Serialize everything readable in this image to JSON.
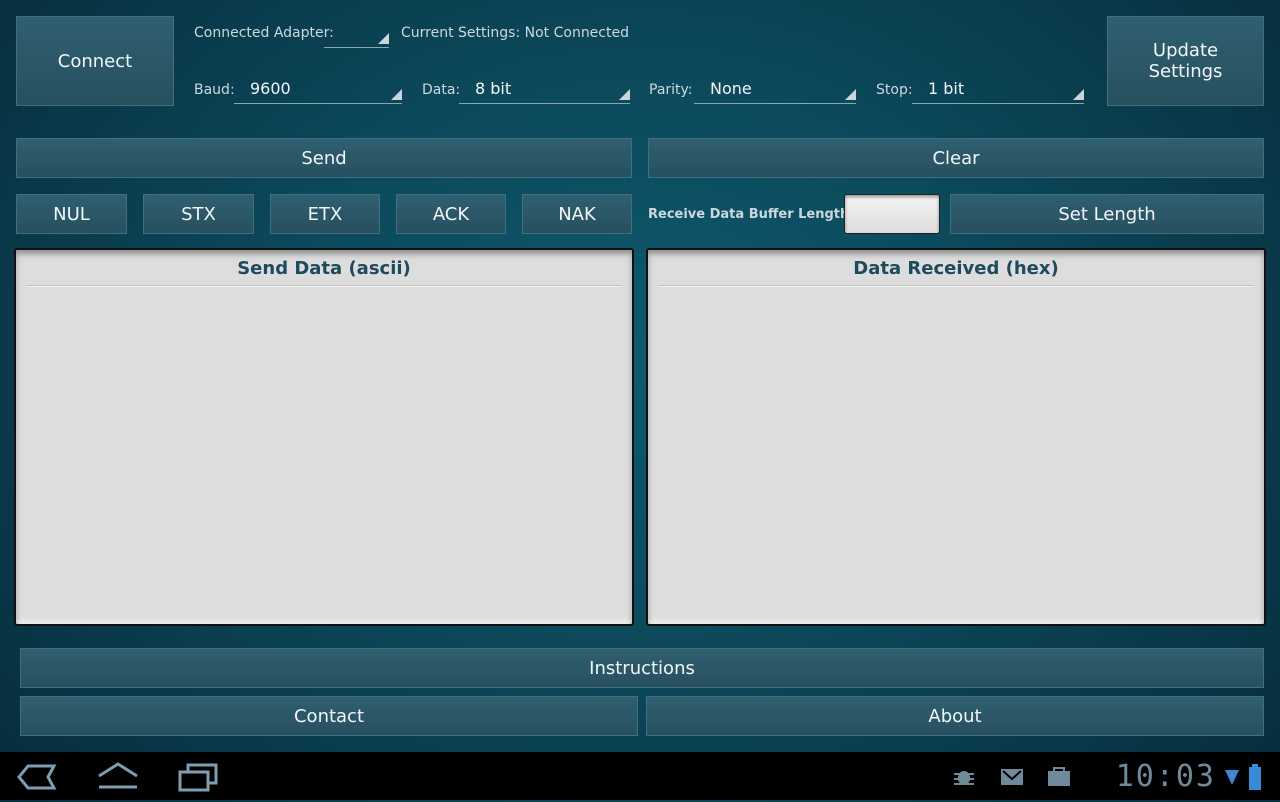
{
  "top": {
    "connect_label": "Connect",
    "update_label_line1": "Update",
    "update_label_line2": "Settings",
    "connected_adapter_label": "Connected Adapter:",
    "connected_adapter_value": "",
    "current_settings": "Current Settings: Not Connected",
    "baud_label": "Baud:",
    "baud_value": "9600",
    "data_label": "Data:",
    "data_value": "8 bit",
    "parity_label": "Parity:",
    "parity_value": "None",
    "stop_label": "Stop:",
    "stop_value": "1 bit"
  },
  "actions": {
    "send_label": "Send",
    "clear_label": "Clear",
    "control_chars": [
      "NUL",
      "STX",
      "ETX",
      "ACK",
      "NAK"
    ],
    "buffer_label": "Receive Data Buffer Length:",
    "buffer_value": "",
    "set_length_label": "Set Length"
  },
  "panels": {
    "send_title": "Send Data (ascii)",
    "received_title": "Data Received (hex)"
  },
  "bottom": {
    "instructions_label": "Instructions",
    "contact_label": "Contact",
    "about_label": "About"
  },
  "system_bar": {
    "clock": "10:03",
    "icons": [
      "back-icon",
      "home-icon",
      "recent-apps-icon",
      "debug-icon",
      "gmail-icon",
      "market-icon",
      "wifi-icon",
      "battery-icon"
    ],
    "icon_color": "#6f8a9a"
  }
}
